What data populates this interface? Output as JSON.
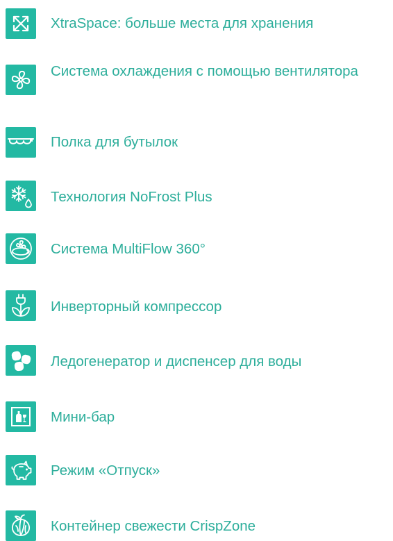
{
  "features": [
    {
      "label": "XtraSpace: больше места для хранения",
      "icon": "expand-arrows-icon"
    },
    {
      "label": "Система охлаждения с помощью вентилятора",
      "icon": "fan-icon"
    },
    {
      "label": "Полка для бутылок",
      "icon": "bottle-shelf-icon"
    },
    {
      "label": "Технология NoFrost Plus",
      "icon": "snowflake-drop-icon"
    },
    {
      "label": "Система MultiFlow 360°",
      "icon": "multiflow-icon"
    },
    {
      "label": "Инверторный компрессор",
      "icon": "plug-leaf-icon"
    },
    {
      "label": "Ледогенератор и диспенсер для воды",
      "icon": "ice-cubes-icon"
    },
    {
      "label": "Мини-бар",
      "icon": "minibar-icon"
    },
    {
      "label": "Режим «Отпуск»",
      "icon": "piggy-bank-icon"
    },
    {
      "label": "Контейнер свежести CrispZone",
      "icon": "vegetables-icon"
    }
  ],
  "colors": {
    "icon_background": "#23b9a3",
    "text": "#2dae9b"
  }
}
